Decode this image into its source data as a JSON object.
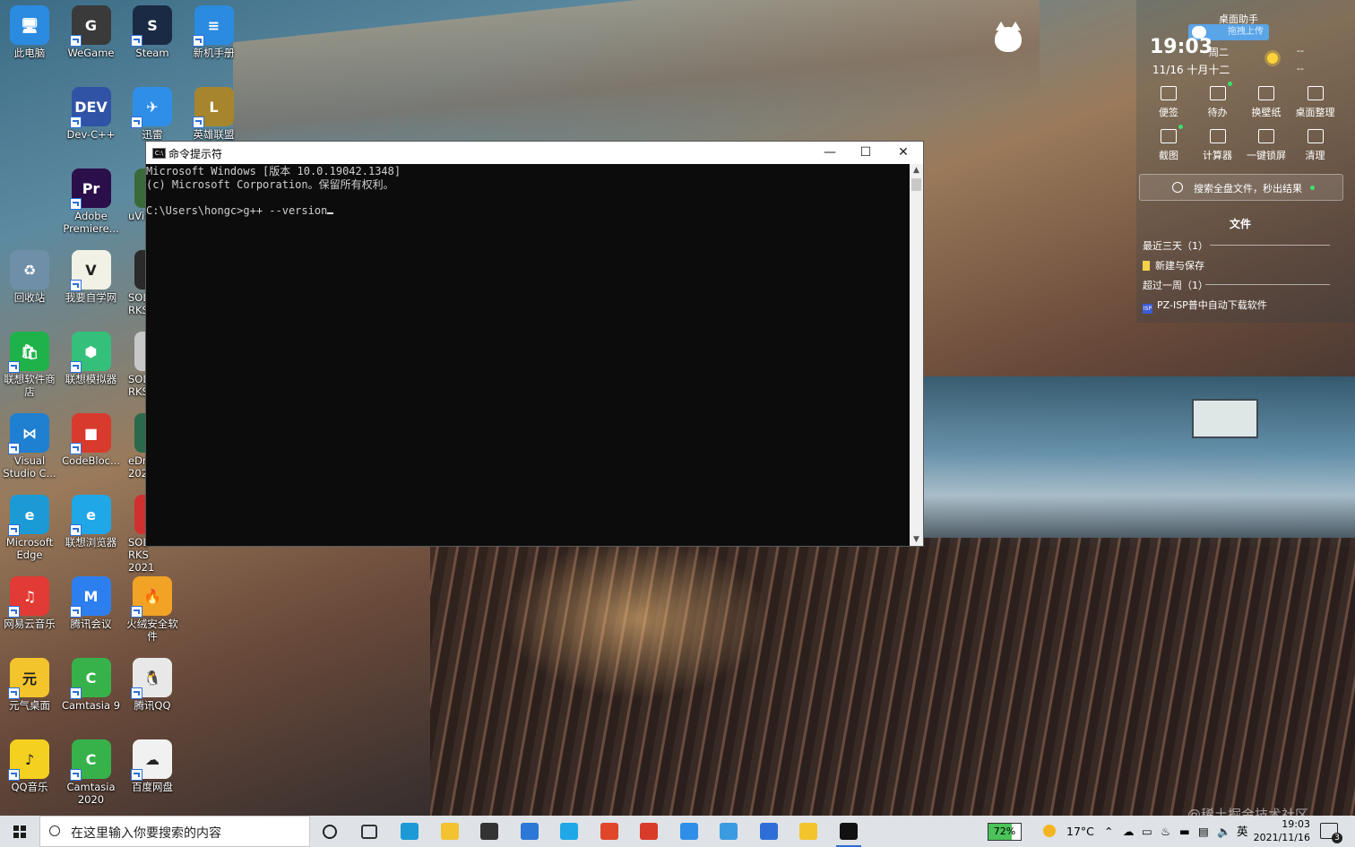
{
  "desktop": {
    "icons": [
      {
        "label": "此电脑",
        "glyph": "🖥",
        "color": "#2b8be0"
      },
      {
        "label": "WeGame",
        "glyph": "G",
        "color": "#3a3a3a"
      },
      {
        "label": "Steam",
        "glyph": "S",
        "color": "#1b2a44"
      },
      {
        "label": "新机手册",
        "glyph": "≡",
        "color": "#2b8be0"
      },
      {
        "label": "Dev-C++",
        "glyph": "DEV",
        "color": "#3153a6"
      },
      {
        "label": "迅雷",
        "glyph": "✈",
        "color": "#2f8fe8"
      },
      {
        "label": "英雄联盟",
        "glyph": "L",
        "color": "#a7852c"
      },
      {
        "label": "Adobe Premiere...",
        "glyph": "Pr",
        "color": "#2a0f4a"
      },
      {
        "label": "回收站",
        "glyph": "♻",
        "color": "#6f8fa8"
      },
      {
        "label": "我要自学网",
        "glyph": "V",
        "color": "#f1f1e6"
      },
      {
        "label": "联想软件商店",
        "glyph": "🛍",
        "color": "#1fb24a"
      },
      {
        "label": "联想模拟器",
        "glyph": "⬢",
        "color": "#34c07a"
      },
      {
        "label": "Visual Studio C...",
        "glyph": "⋈",
        "color": "#1f7fd0"
      },
      {
        "label": "CodeBloc...",
        "glyph": "■",
        "color": "#d93a2e"
      },
      {
        "label": "Microsoft Edge",
        "glyph": "e",
        "color": "#1b9ad6"
      },
      {
        "label": "联想浏览器",
        "glyph": "e",
        "color": "#1fa7e8"
      },
      {
        "label": "网易云音乐",
        "glyph": "♫",
        "color": "#e23a34"
      },
      {
        "label": "腾讯会议",
        "glyph": "M",
        "color": "#2d7ff0"
      },
      {
        "label": "火绒安全软件",
        "glyph": "🔥",
        "color": "#f2a326"
      },
      {
        "label": "元气桌面",
        "glyph": "元",
        "color": "#f3c42b"
      },
      {
        "label": "Camtasia 9",
        "glyph": "C",
        "color": "#37b24a"
      },
      {
        "label": "腾讯QQ",
        "glyph": "🐧",
        "color": "#e8e8e8"
      },
      {
        "label": "QQ音乐",
        "glyph": "♪",
        "color": "#f5d11f"
      },
      {
        "label": "Camtasia 2020",
        "glyph": "C",
        "color": "#37b24a"
      },
      {
        "label": "百度网盘",
        "glyph": "☁",
        "color": "#f1f1f1"
      }
    ],
    "partial_icons": [
      {
        "label": "uVi",
        "color": "#3a6a3a"
      },
      {
        "label": "SOL RKS",
        "color": "#2a2a2a"
      },
      {
        "label": "SOL RKS",
        "color": "#c8c8c8"
      },
      {
        "label": "eDra 202",
        "color": "#2a6a4a"
      },
      {
        "label": "SOL RKS 2021",
        "color": "#d03030"
      }
    ]
  },
  "cmd_window": {
    "title": "命令提示符",
    "title_icon": "C:\\",
    "lines": [
      "Microsoft Windows [版本 10.0.19042.1348]",
      "(c) Microsoft Corporation。保留所有权利。",
      "",
      "C:\\Users\\hongc>g++ --version"
    ],
    "minimize_icon": "—",
    "maximize_icon": "☐",
    "close_icon": "✕"
  },
  "widget": {
    "title": "桌面助手",
    "upload_button": "拖拽上传",
    "time": "19:03",
    "weekday": "周二",
    "date": "11/16 十月十二",
    "temp_high": "--",
    "temp_low": "--",
    "tools": [
      {
        "label": "便签",
        "dot": false
      },
      {
        "label": "待办",
        "dot": true
      },
      {
        "label": "换壁纸",
        "dot": false
      },
      {
        "label": "桌面整理",
        "dot": false
      },
      {
        "label": "截图",
        "dot": true
      },
      {
        "label": "计算器",
        "dot": false
      },
      {
        "label": "一键锁屏",
        "dot": false
      },
      {
        "label": "清理",
        "dot": false
      }
    ],
    "search_text": "搜索全盘文件，秒出结果",
    "files_header": "文件",
    "recent_group": "最近三天（1）",
    "recent_item": "新建与保存",
    "older_group": "超过一周（1）",
    "older_item": "PZ-ISP普中自动下载软件",
    "isp_icon_text": "ISP"
  },
  "watermark": "@稀土掘金技术社区",
  "taskbar": {
    "search_placeholder": "在这里输入你要搜索的内容",
    "apps": [
      {
        "name": "cortana",
        "color": "#222222"
      },
      {
        "name": "task-view",
        "color": "#333333"
      },
      {
        "name": "edge",
        "color": "#1b9ad6"
      },
      {
        "name": "file-explorer",
        "color": "#f2c230"
      },
      {
        "name": "store",
        "color": "#333333"
      },
      {
        "name": "mail",
        "color": "#2b78d6"
      },
      {
        "name": "lenovo-browser",
        "color": "#1fa7e8"
      },
      {
        "name": "office",
        "color": "#e0472a"
      },
      {
        "name": "office-2",
        "color": "#d83b2a"
      },
      {
        "name": "xunlei",
        "color": "#2f8fe8"
      },
      {
        "name": "baidu-netdisk",
        "color": "#3b9be0"
      },
      {
        "name": "photos",
        "color": "#2d6fd6"
      },
      {
        "name": "yuanqi",
        "color": "#f3c42b"
      },
      {
        "name": "cmd",
        "color": "#111111"
      }
    ],
    "battery": "72%",
    "weather_temp": "17°C",
    "ime": "英",
    "clock_time": "19:03",
    "clock_date": "2021/11/16",
    "notification_count": "3"
  }
}
